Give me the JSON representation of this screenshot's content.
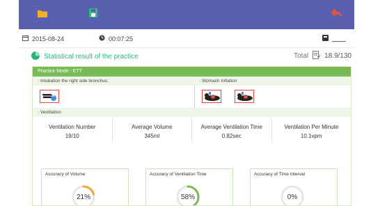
{
  "topbar": {
    "folder_icon": "folder-icon",
    "save_icon": "save-icon",
    "back_icon": "back-arrow-icon",
    "colors": {
      "background": "#5a5fb0",
      "folder": "#f7b023",
      "save": "#2bbf79",
      "back": "#e8543a"
    }
  },
  "info": {
    "date": "2015-08-24",
    "duration": "00:07:25"
  },
  "stats": {
    "title": "Statistical result of the practice",
    "total_label": "Total",
    "total_value": "18.9/130"
  },
  "practice": {
    "mode": "Practice Mode : ETT",
    "errors_left_title": "· Intubation the right side bronchus.",
    "errors_right_title": "· Stomach Inflation",
    "ventilation_title": "· Ventilation"
  },
  "ventilation": {
    "headers": [
      "Ventilation Number",
      "Average Volume",
      "Average Ventilation Time",
      "Ventilation Per Minute"
    ],
    "values": [
      "19/10",
      "345ml",
      "0.82sec",
      "10.1vpm"
    ]
  },
  "accuracy": [
    {
      "label": "Accuracy of Volume",
      "value": "21%",
      "fraction": 0.21,
      "color": "#f4a23a"
    },
    {
      "label": "Accuracy of Ventilation Time",
      "value": "58%",
      "fraction": 0.58,
      "color": "#79b956"
    },
    {
      "label": "Accuracy of Time Interval",
      "value": "0%",
      "fraction": 0.0,
      "color": "#f4a23a"
    }
  ]
}
